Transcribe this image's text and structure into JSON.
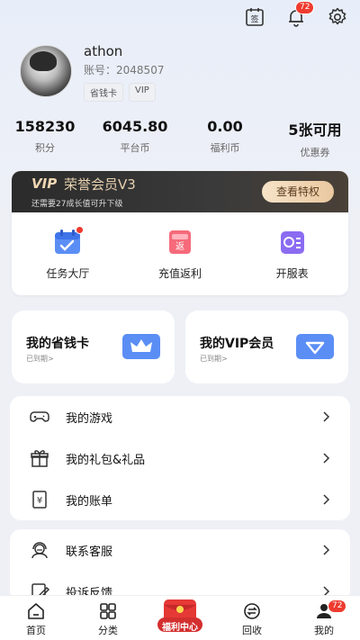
{
  "header": {
    "icons": [
      "sign-in-icon",
      "bell-icon",
      "gear-icon"
    ],
    "notification_count": "72"
  },
  "profile": {
    "name": "athon",
    "account_label": "账号：",
    "account_id": "2048507",
    "tags": [
      "省钱卡",
      "VIP"
    ]
  },
  "stats": [
    {
      "value": "158230",
      "label": "积分"
    },
    {
      "value": "6045.80",
      "label": "平台币"
    },
    {
      "value": "0.00",
      "label": "福利币"
    },
    {
      "value": "5张可用",
      "label": "优惠券"
    }
  ],
  "vip": {
    "logo": "VIP",
    "level": "荣誉会员V3",
    "progress_text": "还需要27成长值可升下级",
    "button": "查看特权"
  },
  "quick": [
    {
      "label": "任务大厅",
      "icon": "task-calendar-icon",
      "dot": true
    },
    {
      "label": "充值返利",
      "icon": "recharge-rebate-icon",
      "dot": false
    },
    {
      "label": "开服表",
      "icon": "server-list-icon",
      "dot": false
    }
  ],
  "cards": [
    {
      "title": "我的省钱卡",
      "sub": "已到期>",
      "icon": "crown-card-icon"
    },
    {
      "title": "我的VIP会员",
      "sub": "已到期>",
      "icon": "vip-diamond-icon"
    }
  ],
  "menu1": [
    {
      "label": "我的游戏",
      "icon": "gamepad-icon"
    },
    {
      "label": "我的礼包&礼品",
      "icon": "gift-icon"
    },
    {
      "label": "我的账单",
      "icon": "bill-icon"
    }
  ],
  "menu2": [
    {
      "label": "联系客服",
      "icon": "customer-service-icon"
    },
    {
      "label": "投诉反馈",
      "icon": "feedback-icon"
    }
  ],
  "tabbar": [
    {
      "label": "首页",
      "icon": "home-icon"
    },
    {
      "label": "分类",
      "icon": "category-icon"
    },
    {
      "label": "福利中心",
      "icon": "welfare-center-icon"
    },
    {
      "label": "回收",
      "icon": "recycle-icon"
    },
    {
      "label": "我的",
      "icon": "profile-icon",
      "badge": "72"
    }
  ],
  "colors": {
    "accent_red": "#ee3b2f",
    "vip_gold": "#e9c8a0",
    "icon_blue": "#4a7cf0"
  }
}
